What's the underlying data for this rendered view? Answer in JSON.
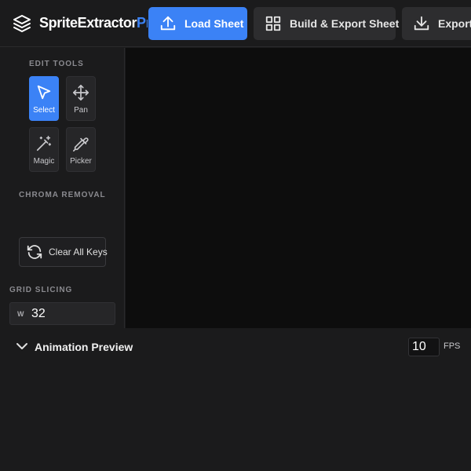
{
  "app": {
    "brand_part1": "SpriteExtractor",
    "brand_part2": "Pro"
  },
  "header": {
    "load_label": "Load Sheet",
    "build_label": "Build & Export Sheet",
    "export_label": "Export"
  },
  "sidebar": {
    "edit_tools_title": "EDIT TOOLS",
    "tools": [
      {
        "label": "Select",
        "icon": "cursor-icon",
        "active": true
      },
      {
        "label": "Pan",
        "icon": "move-icon",
        "active": false
      },
      {
        "label": "Magic",
        "icon": "magic-wand-icon",
        "active": false
      },
      {
        "label": "Picker",
        "icon": "eyedropper-icon",
        "active": false
      }
    ],
    "chroma_title": "CHROMA REMOVAL",
    "clear_keys_label": "Clear All Keys",
    "grid_title": "GRID SLICING",
    "grid_w_label": "W",
    "grid_w_value": "32"
  },
  "preview": {
    "title": "Animation Preview",
    "fps_value": "10",
    "fps_label": "FPS"
  },
  "colors": {
    "accent": "#3b82f6",
    "canvas": "#0d0d0d",
    "panel": "#1b1b1c"
  }
}
